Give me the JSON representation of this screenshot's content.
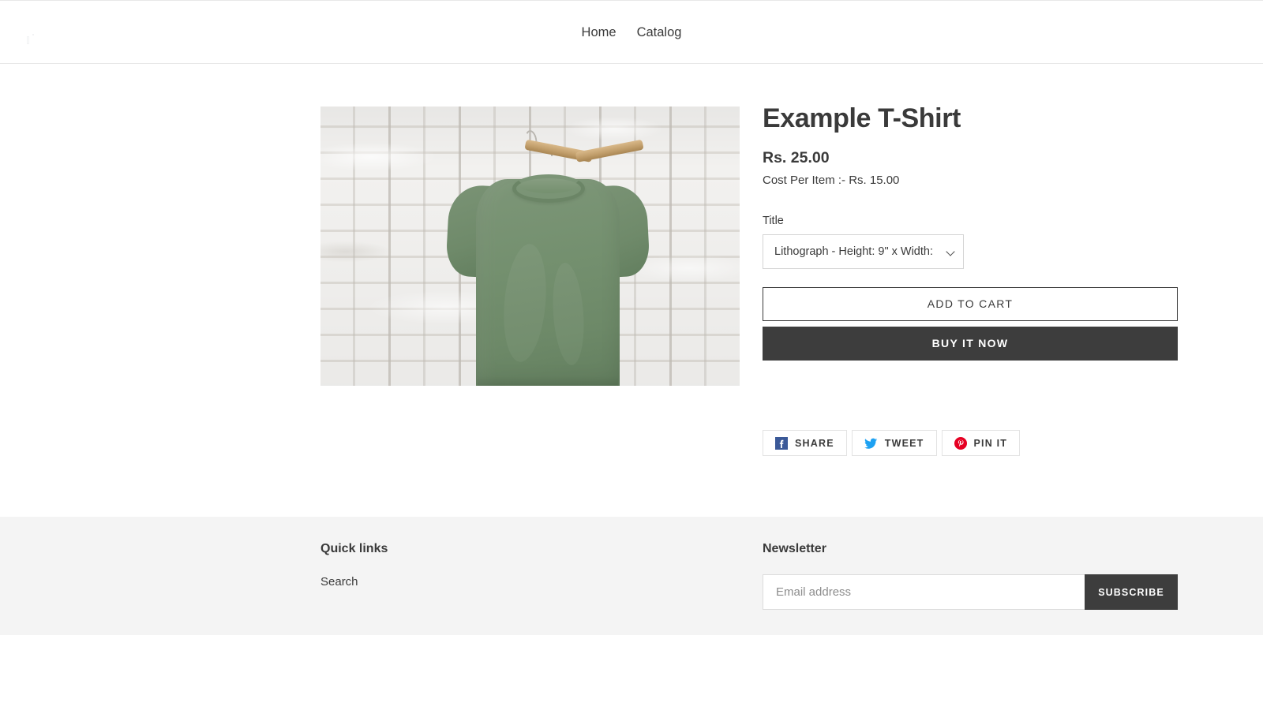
{
  "header": {
    "logo_name": "broken-image-logo",
    "nav": [
      {
        "label": "Home",
        "name": "nav-link-home"
      },
      {
        "label": "Catalog",
        "name": "nav-link-catalog"
      }
    ]
  },
  "product": {
    "image_alt": "Green t-shirt on wooden hanger against white brick wall",
    "title": "Example T-Shirt",
    "price": "Rs. 25.00",
    "cost_per_item": "Cost Per Item :- Rs. 15.00",
    "variant": {
      "label": "Title",
      "selected": "Lithograph - Height: 9\" x Width:",
      "options": [
        "Lithograph - Height: 9\" x Width:"
      ]
    },
    "add_to_cart_label": "Add to cart",
    "buy_now_label": "Buy it now"
  },
  "share": {
    "buttons": [
      {
        "label": "Share",
        "icon": "facebook-icon",
        "color": "#3b5998"
      },
      {
        "label": "Tweet",
        "icon": "twitter-icon",
        "color": "#1da1f2"
      },
      {
        "label": "Pin it",
        "icon": "pinterest-icon",
        "color": "#e60023"
      }
    ]
  },
  "footer": {
    "quick_links": {
      "heading": "Quick links",
      "items": [
        {
          "label": "Search",
          "name": "footer-link-search"
        }
      ]
    },
    "newsletter": {
      "heading": "Newsletter",
      "email_placeholder": "Email address",
      "email_value": "",
      "subscribe_label": "Subscribe"
    }
  },
  "colors": {
    "text": "#3a3a3a",
    "dark_button": "#3d3d3d",
    "footer_bg": "#f4f4f4",
    "border": "#e8e8e8",
    "shirt_green": "#74906f",
    "hanger_wood": "#c29f6c"
  }
}
